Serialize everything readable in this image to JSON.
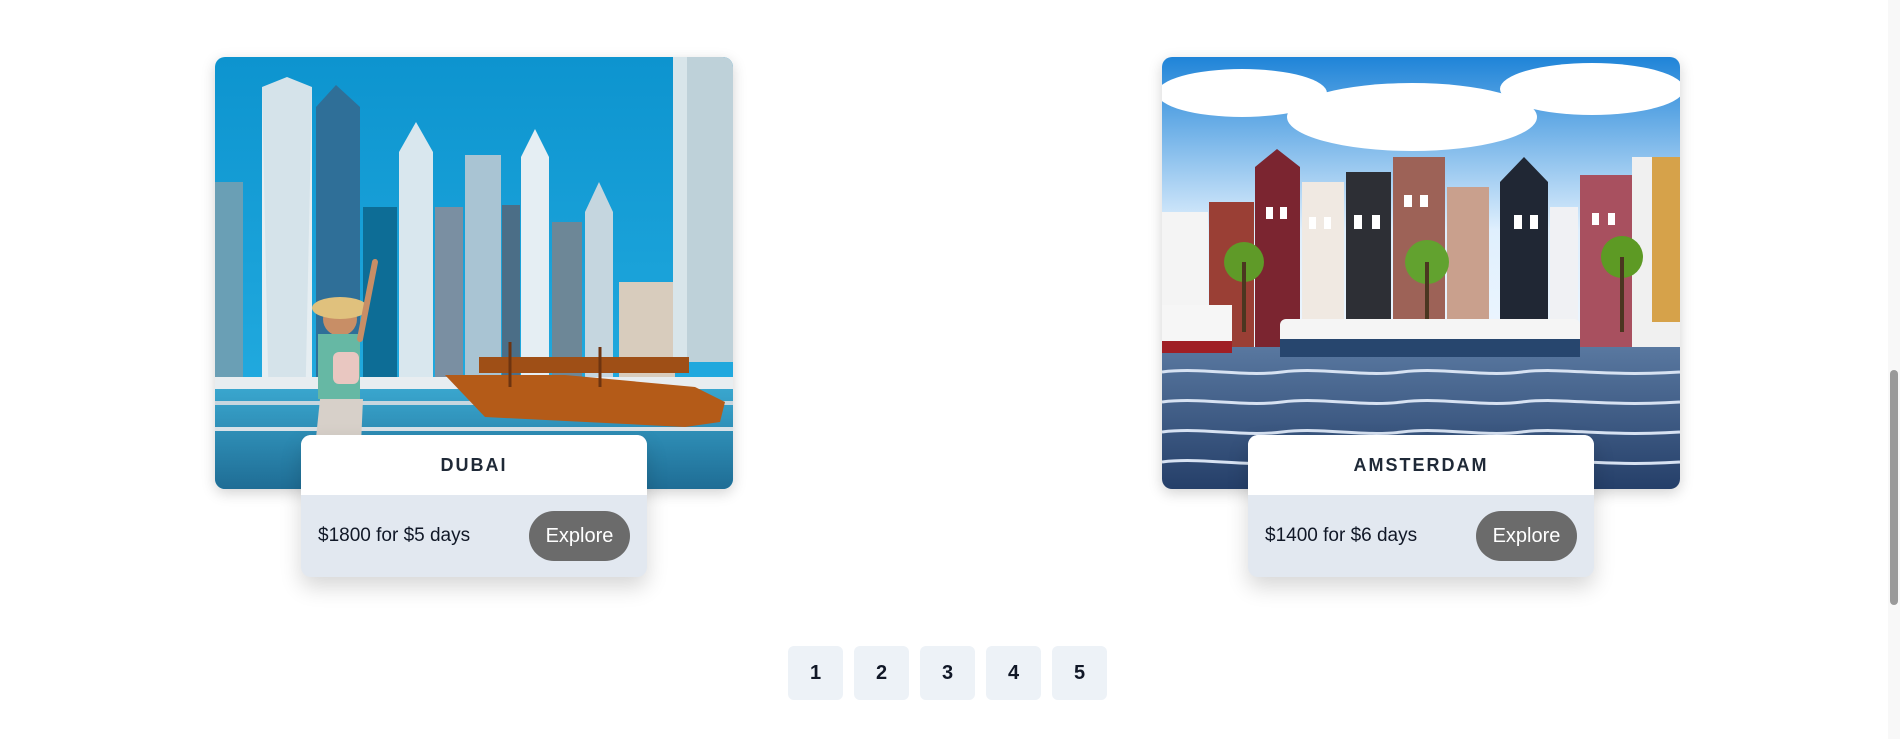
{
  "destinations": [
    {
      "name": "DUBAI",
      "price": "$1800 for $5 days",
      "button_label": "Explore"
    },
    {
      "name": "AMSTERDAM",
      "price": "$1400 for $6 days",
      "button_label": "Explore"
    }
  ],
  "pagination": {
    "pages": [
      "1",
      "2",
      "3",
      "4",
      "5"
    ]
  },
  "colors": {
    "button_bg": "#6b6b6b",
    "info_bg": "#e2e8f0",
    "page_button_bg": "#edf2f7"
  }
}
